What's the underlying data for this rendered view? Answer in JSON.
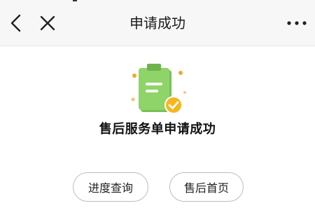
{
  "nav": {
    "title": "申请成功",
    "back_icon": "chevron-left-icon",
    "close_icon": "close-icon",
    "more_icon": "more-dots-icon"
  },
  "result": {
    "message": "售后服务单申请成功",
    "illustration_icon": "clipboard-check-icon"
  },
  "actions": {
    "progress_label": "进度查询",
    "home_label": "售后首页"
  },
  "colors": {
    "clipboard_green": "#8ed468",
    "check_badge": "#f6b61e",
    "nav_background": "#f7f7f7",
    "accent_dots": "#f6a623"
  }
}
